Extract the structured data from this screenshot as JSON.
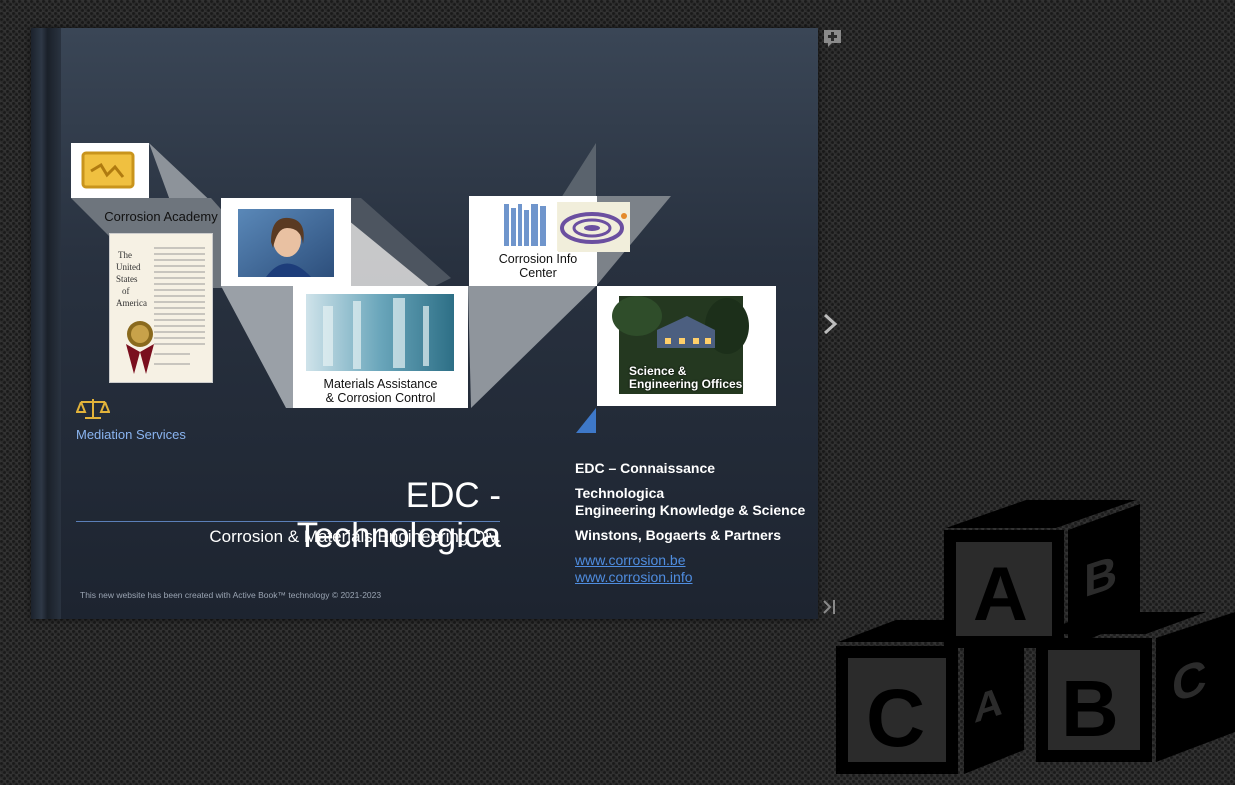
{
  "book": {
    "left_panel": {
      "corrosion_academy": "Corrosion Academy",
      "materials_assistance": [
        "Materials Assistance",
        "& Corrosion Control"
      ],
      "mediation": "Mediation Services"
    },
    "right_panel": {
      "info_center": [
        "Corrosion Info",
        "Center"
      ],
      "science_offices": [
        "Science &",
        "Engineering Offices"
      ]
    },
    "title": "EDC - Technologica",
    "subtitle": "Corrosion & Materials Engineering Div.",
    "info": {
      "line1": "EDC – Connaissance",
      "line2a": "Technologica",
      "line2b": "Engineering Knowledge & Science",
      "line3": "Winstons, Bogaerts & Partners",
      "link1": "www.corrosion.be",
      "link2": "www.corrosion.info"
    },
    "footer": "This new website has been created with Active Book™ technology  © 2021-2023"
  },
  "controls": {
    "add_icon": "add-note-icon",
    "next_icon": "chevron-right-icon",
    "last_icon": "skip-to-end-icon"
  },
  "decoration": {
    "blocks": [
      {
        "letter": "A"
      },
      {
        "letter": "B"
      },
      {
        "letter": "C"
      },
      {
        "letter": "A"
      },
      {
        "letter": "B"
      },
      {
        "letter": "C"
      }
    ]
  },
  "colors": {
    "accent": "#4f8de0",
    "gold": "#e2b33a",
    "med_text": "#8ab4f0"
  }
}
